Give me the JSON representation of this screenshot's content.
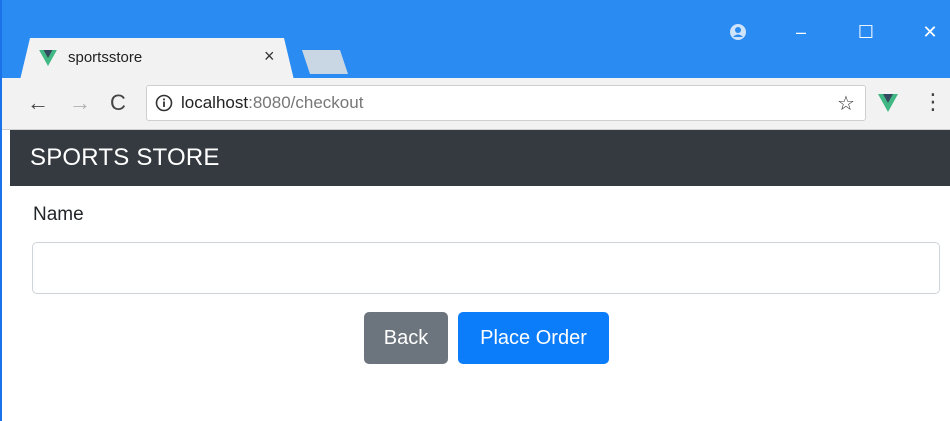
{
  "browser": {
    "tab_title": "sportsstore",
    "tab_close": "×",
    "url_host": "localhost",
    "url_rest": ":8080/checkout",
    "controls": {
      "minimize": "–",
      "maximize": "☐",
      "close": "✕"
    }
  },
  "app": {
    "brand": "SPORTS STORE"
  },
  "form": {
    "name_label": "Name",
    "name_value": "",
    "back_label": "Back",
    "place_order_label": "Place Order"
  },
  "colors": {
    "titlebar": "#2a8bf2",
    "navbar": "#343a40",
    "back_button": "#6c757d",
    "primary_button": "#0b7dfb",
    "vue_green": "#41b883"
  },
  "icons": [
    "vue-favicon-icon",
    "profile-icon",
    "back-arrow-icon",
    "forward-arrow-icon",
    "reload-icon",
    "info-icon",
    "star-icon",
    "vue-extension-icon",
    "kebab-menu-icon"
  ]
}
